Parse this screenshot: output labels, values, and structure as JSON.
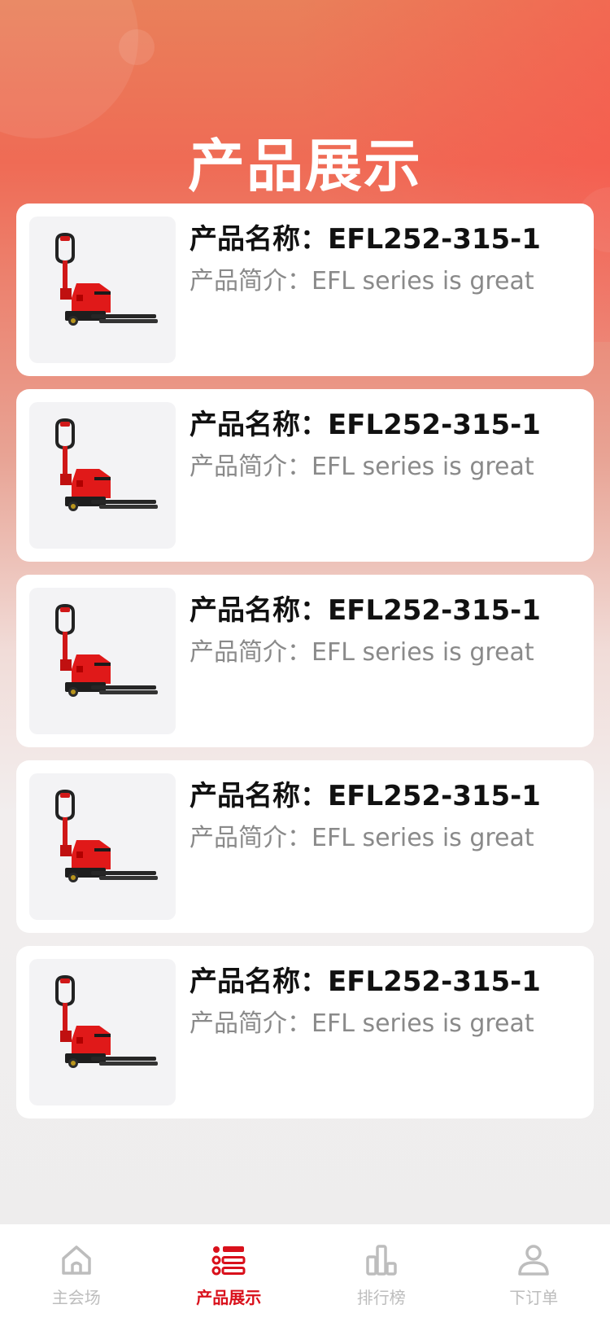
{
  "page": {
    "title": "产品展示",
    "colors": {
      "accent": "#d9101b",
      "gradient_top": "#e9805a",
      "gradient_red": "#ef6b55"
    }
  },
  "products": [
    {
      "name": "产品名称：EFL252-315-1",
      "desc": "产品简介：EFL series is great",
      "image_icon": "pallet-truck-image"
    },
    {
      "name": "产品名称：EFL252-315-1",
      "desc": "产品简介：EFL series is great",
      "image_icon": "pallet-truck-image"
    },
    {
      "name": "产品名称：EFL252-315-1",
      "desc": "产品简介：EFL series is great",
      "image_icon": "pallet-truck-image"
    },
    {
      "name": "产品名称：EFL252-315-1",
      "desc": "产品简介：EFL series is great",
      "image_icon": "pallet-truck-image"
    },
    {
      "name": "产品名称：EFL252-315-1",
      "desc": "产品简介：EFL series is great",
      "image_icon": "pallet-truck-image"
    }
  ],
  "tabbar": {
    "items": [
      {
        "label": "主会场",
        "icon": "home-icon",
        "active": false
      },
      {
        "label": "产品展示",
        "icon": "list-icon",
        "active": true
      },
      {
        "label": "排行榜",
        "icon": "bar-chart-icon",
        "active": false
      },
      {
        "label": "下订单",
        "icon": "user-icon",
        "active": false
      }
    ]
  }
}
